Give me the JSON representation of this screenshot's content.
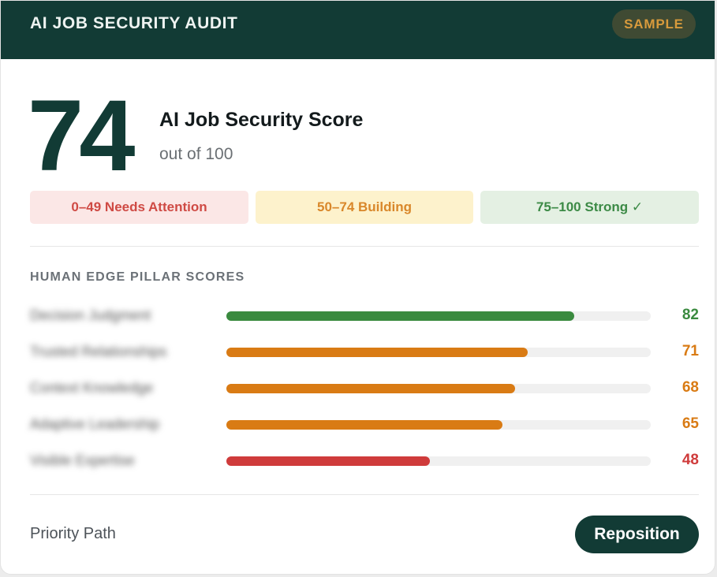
{
  "header": {
    "title": "AI JOB SECURITY AUDIT",
    "badge": "SAMPLE"
  },
  "score": {
    "value": "74",
    "title": "AI Job Security Score",
    "subtitle": "out of 100"
  },
  "ranges": [
    {
      "label": "0–49 Needs Attention",
      "color": "#cf4a44"
    },
    {
      "label": "50–74 Building",
      "color": "#d9872a"
    },
    {
      "label": "75–100 Strong ✓",
      "color": "#3c8a46"
    }
  ],
  "pillars": {
    "title": "HUMAN EDGE PILLAR SCORES",
    "items": [
      {
        "name": "Decision Judgment",
        "score": 82,
        "display": "82",
        "color": "#3a8a3f"
      },
      {
        "name": "Trusted Relationships",
        "score": 71,
        "display": "71",
        "color": "#d97b14"
      },
      {
        "name": "Context Knowledge",
        "score": 68,
        "display": "68",
        "color": "#d97b14"
      },
      {
        "name": "Adaptive Leadership",
        "score": 65,
        "display": "65",
        "color": "#d97b14"
      },
      {
        "name": "Visible Expertise",
        "score": 48,
        "display": "48",
        "color": "#cf3b3b"
      }
    ]
  },
  "footer": {
    "label": "Priority Path",
    "button": "Reposition"
  }
}
